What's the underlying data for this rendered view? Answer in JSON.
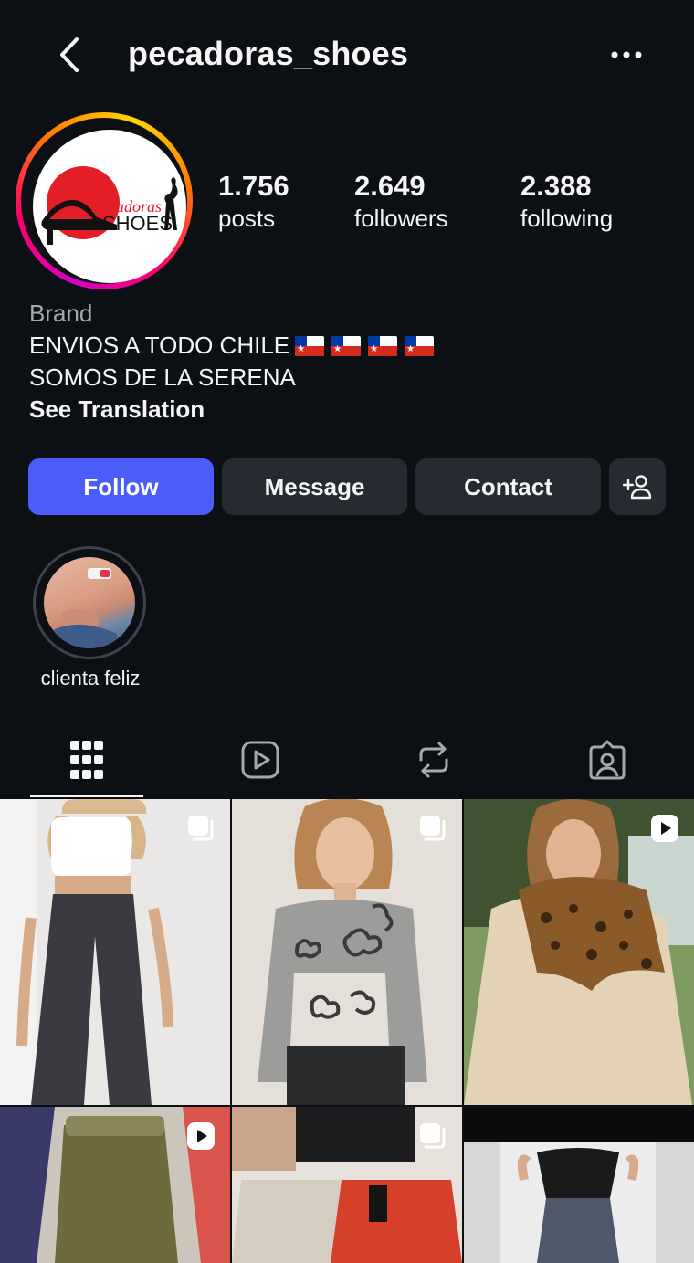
{
  "header": {
    "username": "pecadoras_shoes",
    "back_icon": "chevron-left-icon",
    "more_icon": "more-horizontal-icon"
  },
  "profile": {
    "logo_text_1": "Pecadoras",
    "logo_text_2": "SHOES",
    "stats": [
      {
        "value": "1.756",
        "label": "posts"
      },
      {
        "value": "2.649",
        "label": "followers"
      },
      {
        "value": "2.388",
        "label": "following"
      }
    ]
  },
  "bio": {
    "category": "Brand",
    "line1": "ENVIOS A TODO CHILE",
    "line2": "SOMOS DE LA SERENA",
    "translate": "See Translation"
  },
  "actions": {
    "follow": "Follow",
    "message": "Message",
    "contact": "Contact",
    "add_icon": "add-person-icon"
  },
  "highlights": [
    {
      "label": "clienta feliz"
    }
  ],
  "tabs": [
    {
      "icon": "grid-icon",
      "active": true
    },
    {
      "icon": "reels-icon",
      "active": false
    },
    {
      "icon": "reposts-icon",
      "active": false
    },
    {
      "icon": "tagged-icon",
      "active": false
    }
  ],
  "colors": {
    "background": "#0c1014",
    "follow_button": "#4a5df9",
    "secondary_button": "#262a31",
    "muted_text": "#a8a8a8"
  },
  "posts": [
    {
      "badge": "carousel-icon",
      "label": "black-pants-white-top"
    },
    {
      "badge": "carousel-icon",
      "label": "gray-sweater-flowers"
    },
    {
      "badge": "reel-icon",
      "label": "leopard-fleece-sweater"
    },
    {
      "badge": "reel-icon",
      "label": "olive-pants"
    },
    {
      "badge": "carousel-icon",
      "label": "red-skirt"
    },
    {
      "badge": "",
      "label": "jeans-black-top"
    }
  ]
}
